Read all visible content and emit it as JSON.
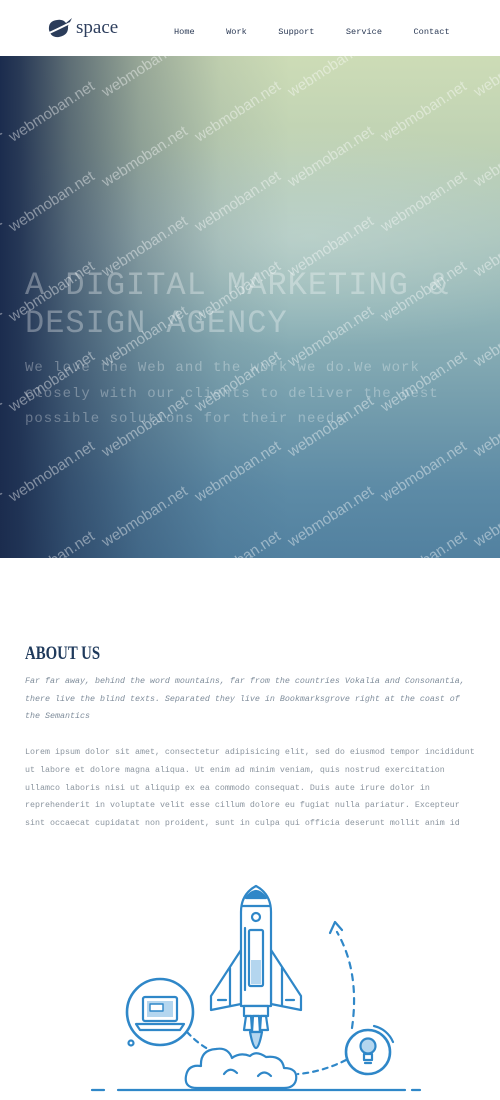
{
  "header": {
    "logo": {
      "icon": "space-logo-icon",
      "text": "space"
    },
    "nav": [
      {
        "label": "Home"
      },
      {
        "label": "Work"
      },
      {
        "label": "Support"
      },
      {
        "label": "Service"
      },
      {
        "label": "Contact"
      }
    ]
  },
  "hero": {
    "title": "A DIGITAL MARKETING & DESIGN AGENCY",
    "subtitle": "We love the Web and the work we do.We work closely with our clients to deliver the best possible solutions for their needs"
  },
  "about": {
    "heading": "ABOUT US",
    "intro": "Far far away, behind the word mountains, far from the countries Vokalia and Consonantia, there live the blind texts. Separated they live in Bookmarksgrove right at the coast of the Semantics",
    "body": "Lorem ipsum dolor sit amet, consectetur adipisicing elit, sed do eiusmod tempor incididunt ut labore et dolore magna aliqua. Ut enim ad minim veniam, quis nostrud exercitation ullamco laboris nisi ut aliquip ex ea commodo consequat. Duis aute irure dolor in reprehenderit in voluptate velit esse cillum dolore eu fugiat nulla pariatur. Excepteur sint occaecat cupidatat non proident, sunt in culpa qui officia deserunt mollit anim id"
  },
  "illustration": {
    "icons": [
      "rocket-icon",
      "laptop-icon",
      "lightbulb-icon",
      "cloud-icon",
      "dashed-arrow-icon"
    ]
  },
  "watermark": {
    "text": "webmoban.net"
  },
  "colors": {
    "brand_navy": "#1f3a5c",
    "nav_text": "#2b3a55",
    "hero_dark": "#1b2c4e",
    "hero_light": "#cddcb6",
    "illustration_blue": "#2f87c8",
    "illustration_light_blue": "#b4d6ef",
    "body_text": "#8b959f"
  }
}
